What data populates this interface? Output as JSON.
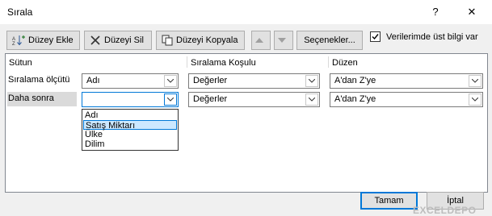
{
  "window": {
    "title": "Sırala",
    "help_label": "?",
    "close_label": "✕"
  },
  "toolbar": {
    "add_level": "Düzey Ekle",
    "delete_level": "Düzeyi Sil",
    "copy_level": "Düzeyi Kopyala",
    "move_up_icon": "arrow-up",
    "move_down_icon": "arrow-down",
    "options": "Seçenekler...",
    "header_checkbox_label": "Verilerimde üst bilgi var",
    "header_checkbox_checked": true
  },
  "columns": {
    "column": "Sütun",
    "sort_on": "Sıralama Koşulu",
    "order": "Düzen"
  },
  "rows": [
    {
      "label": "Sıralama ölçütü",
      "column": "Adı",
      "sort_on": "Değerler",
      "order": "A'dan Z'ye"
    },
    {
      "label": "Daha sonra",
      "column": "",
      "sort_on": "Değerler",
      "order": "A'dan Z'ye"
    }
  ],
  "column_dropdown": {
    "options": [
      "Adı",
      "Satış Miktarı",
      "Ülke",
      "Dilim"
    ],
    "highlighted": "Satış Miktarı"
  },
  "buttons": {
    "ok": "Tamam",
    "cancel": "İptal"
  },
  "watermark": "EXCELDEPO"
}
